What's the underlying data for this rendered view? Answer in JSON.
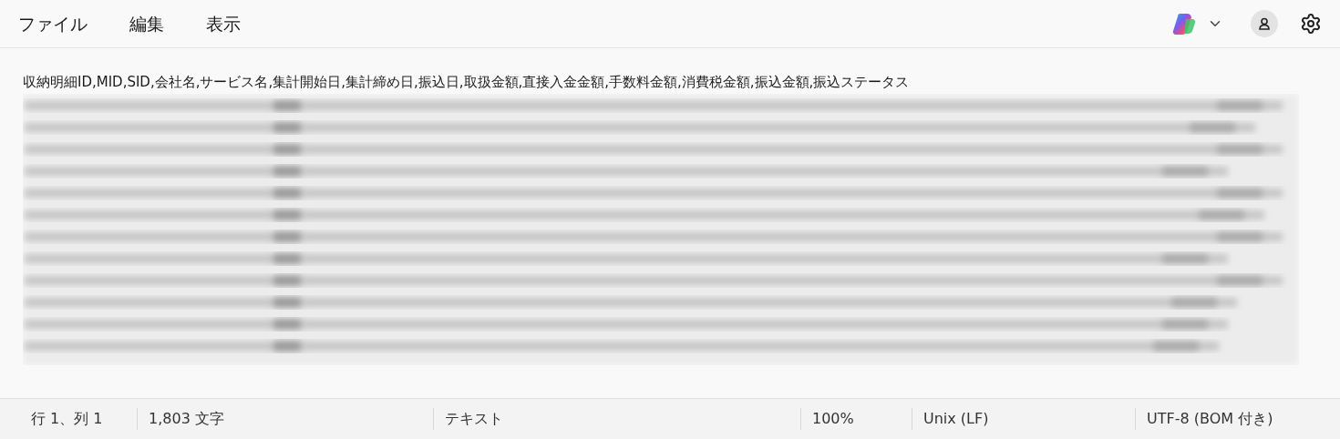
{
  "menu": [
    {
      "label": "ファイル"
    },
    {
      "label": "編集"
    },
    {
      "label": "表示"
    }
  ],
  "editor": {
    "header_line": "収納明細ID,MID,SID,会社名,サービス名,集計開始日,集計締め日,振込日,取扱金額,直接入金金額,手数料金額,消費税金額,振込金額,振込ステータス"
  },
  "status_bar": [
    "行 1、列 1",
    "1,803 文字",
    "テキスト",
    "100%",
    "Unix (LF)",
    "UTF-8 (BOM 付き)"
  ]
}
